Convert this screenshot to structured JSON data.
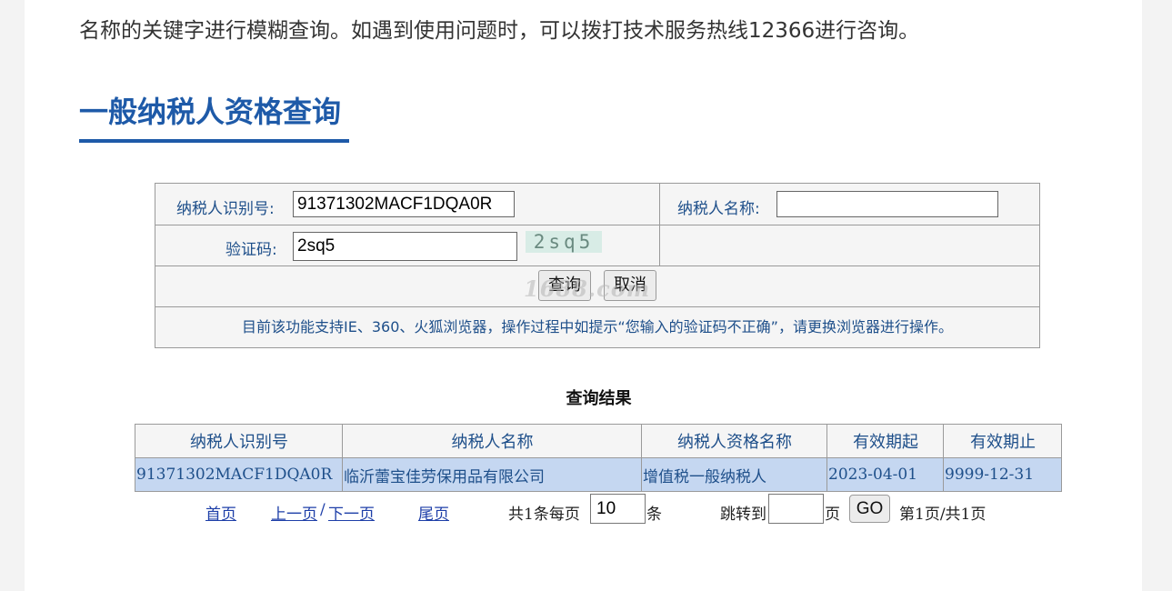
{
  "intro_text": "名称的关键字进行模糊查询。如遇到使用问题时，可以拨打技术服务热线12366进行咨询。",
  "heading": "一般纳税人资格查询",
  "form": {
    "taxpayer_id_label": "纳税人识别号:",
    "taxpayer_id_value": "91371302MACF1DQA0R",
    "taxpayer_name_label": "纳税人名称:",
    "taxpayer_name_value": "",
    "captcha_label": "验证码:",
    "captcha_value": "2sq5",
    "captcha_image_text": "2sq5",
    "query_button": "查询",
    "cancel_button": "取消",
    "watermark": "1688.com",
    "tip": "目前该功能支持IE、360、火狐浏览器，操作过程中如提示“您输入的验证码不正确”，请更换浏览器进行操作。"
  },
  "results": {
    "title": "查询结果",
    "columns": [
      "纳税人识别号",
      "纳税人名称",
      "纳税人资格名称",
      "有效期起",
      "有效期止"
    ],
    "rows": [
      [
        "91371302MACF1DQA0R",
        "临沂蕾宝佳劳保用品有限公司",
        "增值税一般纳税人",
        "2023-04-01",
        "9999-12-31"
      ]
    ]
  },
  "pager": {
    "first": "首页",
    "prev": "上一页",
    "separator": "/",
    "next": "下一页",
    "last": "尾页",
    "summary": "共1条每页",
    "page_size": "10",
    "unit": "条",
    "jump_label": "跳转到",
    "jump_value": "",
    "page_unit": "页",
    "go_button": "GO",
    "page_info": "第1页/共1页"
  }
}
